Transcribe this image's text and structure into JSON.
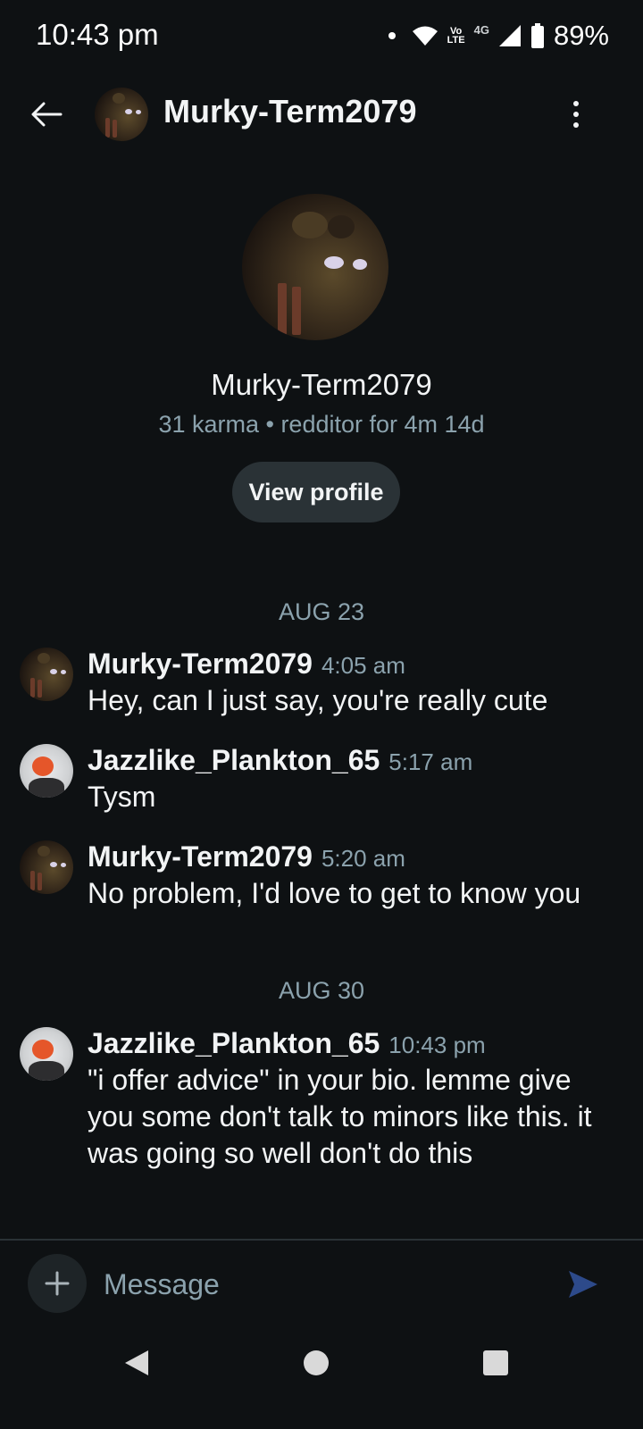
{
  "status_bar": {
    "time": "10:43 pm",
    "volte": "VoLTE",
    "network": "4G",
    "battery": "89%",
    "icons": [
      "notification-dot-icon",
      "wifi-icon",
      "volte-icon",
      "signal-icon",
      "battery-icon"
    ]
  },
  "header": {
    "title": "Murky-Term2079",
    "back_icon": "arrow-left-icon",
    "menu_icon": "more-vertical-icon"
  },
  "profile": {
    "name": "Murky-Term2079",
    "meta": "31 karma • redditor for 4m 14d",
    "view_profile_label": "View profile"
  },
  "conversation": {
    "dates": [
      "AUG 23",
      "AUG 30"
    ],
    "messages": [
      {
        "author": "Murky-Term2079",
        "time": "4:05 am",
        "text": "Hey, can I just say, you're really cute"
      },
      {
        "author": "Jazzlike_Plankton_65",
        "time": "5:17 am",
        "text": "Tysm"
      },
      {
        "author": "Murky-Term2079",
        "time": "5:20 am",
        "text": "No problem, I'd love to get to know you"
      },
      {
        "author": "Jazzlike_Plankton_65",
        "time": "10:43 pm",
        "text": "\"i offer advice\" in your bio. lemme give you some don't talk to minors like this. it was going so well don't do this"
      }
    ]
  },
  "composer": {
    "placeholder": "Message",
    "add_icon": "plus-icon",
    "send_icon": "send-icon",
    "send_color": "#2d4a8a"
  },
  "colors": {
    "background": "#0e1113",
    "text_primary": "#f2f4f5",
    "text_secondary": "#8ba2ad",
    "button_bg": "#2a3236"
  }
}
